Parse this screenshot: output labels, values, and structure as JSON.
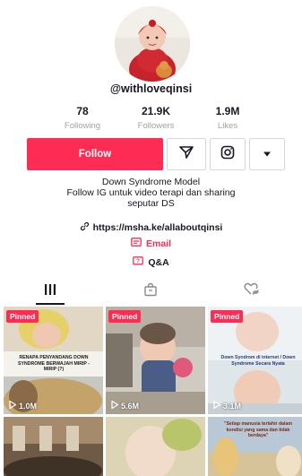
{
  "profile": {
    "username": "@withloveqinsi",
    "stats": [
      {
        "value": "78",
        "label": "Following"
      },
      {
        "value": "21.9K",
        "label": "Followers"
      },
      {
        "value": "1.9M",
        "label": "Likes"
      }
    ],
    "follow_label": "Follow",
    "bio": [
      "Down Syndrome Model",
      "Follow IG untuk video terapi dan sharing",
      "seputar DS"
    ],
    "link": "https://msha.ke/allaboutqinsi",
    "email_label": "Email",
    "qa_label": "Q&A"
  },
  "tabs": [
    {
      "icon": "grid-icon"
    },
    {
      "icon": "shopping-bag-icon"
    },
    {
      "icon": "liked-hidden-icon"
    }
  ],
  "videos": [
    {
      "pinned": "Pinned",
      "views": "1.0M",
      "caption": "RENAPA PENYANDANG DOWN SYNDROME BERWAJAH MIRIP - MIRIP (?)"
    },
    {
      "pinned": "Pinned",
      "views": "5.6M",
      "caption": ""
    },
    {
      "pinned": "Pinned",
      "views": "3.1M",
      "caption": "Down Syndrom di internet / Down Syndrome Secara Nyata"
    },
    {
      "pinned": "",
      "views": "",
      "caption": ""
    },
    {
      "pinned": "",
      "views": "",
      "caption": ""
    },
    {
      "pinned": "",
      "views": "",
      "caption": "\"Setiap manusia terlahir dalam kondisi yang sama dan tidak berdaya\""
    }
  ],
  "colors": {
    "accent": "#fe2c55",
    "text": "#161823",
    "muted": "#a0a1a7",
    "border": "#d6d7da"
  }
}
